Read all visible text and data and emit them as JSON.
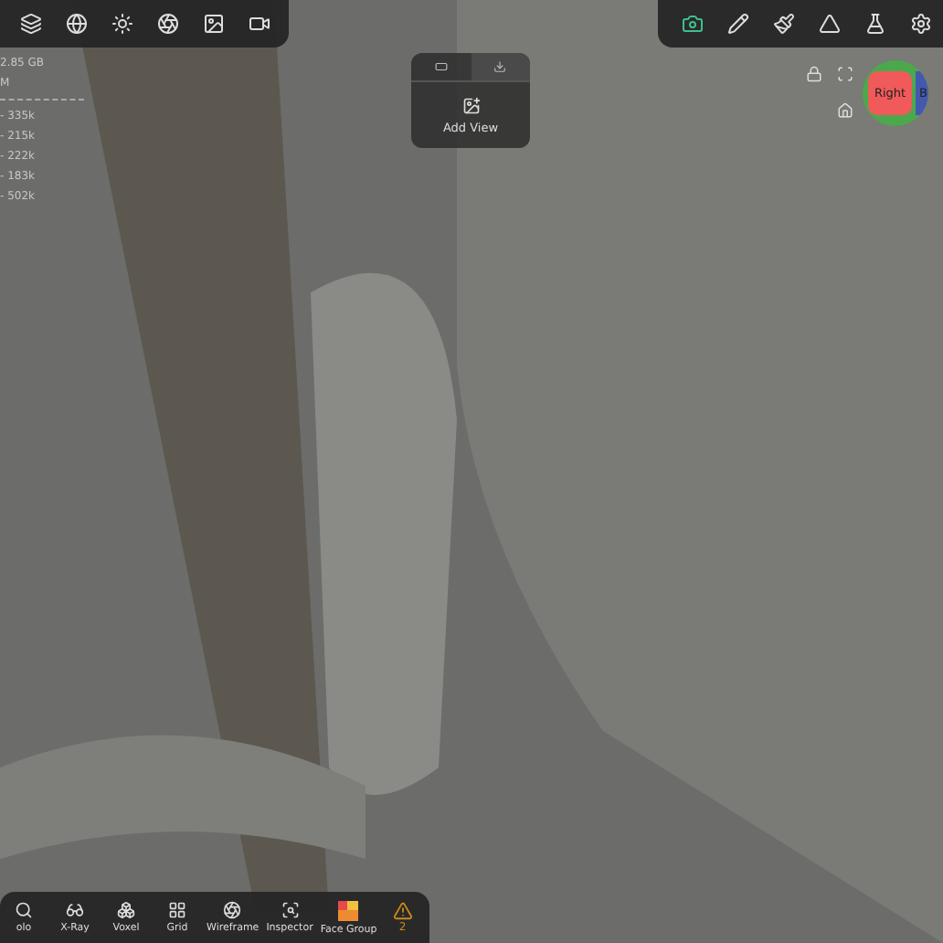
{
  "top_left_toolbar": {
    "items": [
      {
        "kind": "layers",
        "selected": false
      },
      {
        "kind": "globe",
        "selected": false
      },
      {
        "kind": "sun",
        "selected": false
      },
      {
        "kind": "aperture",
        "selected": false
      },
      {
        "kind": "image",
        "selected": false
      },
      {
        "kind": "video",
        "selected": false
      }
    ]
  },
  "stats": {
    "memory": "2.85 GB",
    "unit": "M",
    "counts": [
      "- 335k",
      "- 215k",
      "- 222k",
      "- 183k",
      "- 502k"
    ]
  },
  "view_popup": {
    "tabs": [
      {
        "kind": "camera",
        "selected": false
      },
      {
        "kind": "download",
        "selected": true
      }
    ],
    "action": "Add View"
  },
  "top_right_toolbar": {
    "items": [
      {
        "kind": "camera",
        "selected": true
      },
      {
        "kind": "pencil",
        "selected": false
      },
      {
        "kind": "brush",
        "selected": false
      },
      {
        "kind": "triangle",
        "selected": false
      },
      {
        "kind": "flask",
        "selected": false
      },
      {
        "kind": "settings",
        "selected": false
      }
    ]
  },
  "gizmo": {
    "front_label": "Right",
    "side_label": "B"
  },
  "bottom_toolbar": {
    "items": [
      {
        "kind": "search",
        "label": "olo"
      },
      {
        "kind": "glasses",
        "label": "X-Ray"
      },
      {
        "kind": "boxes",
        "label": "Voxel"
      },
      {
        "kind": "grid",
        "label": "Grid"
      },
      {
        "kind": "aperture",
        "label": "Wireframe"
      },
      {
        "kind": "inspect",
        "label": "Inspector"
      },
      {
        "kind": "facegroup",
        "label": "Face Group"
      }
    ],
    "warning": "2"
  }
}
